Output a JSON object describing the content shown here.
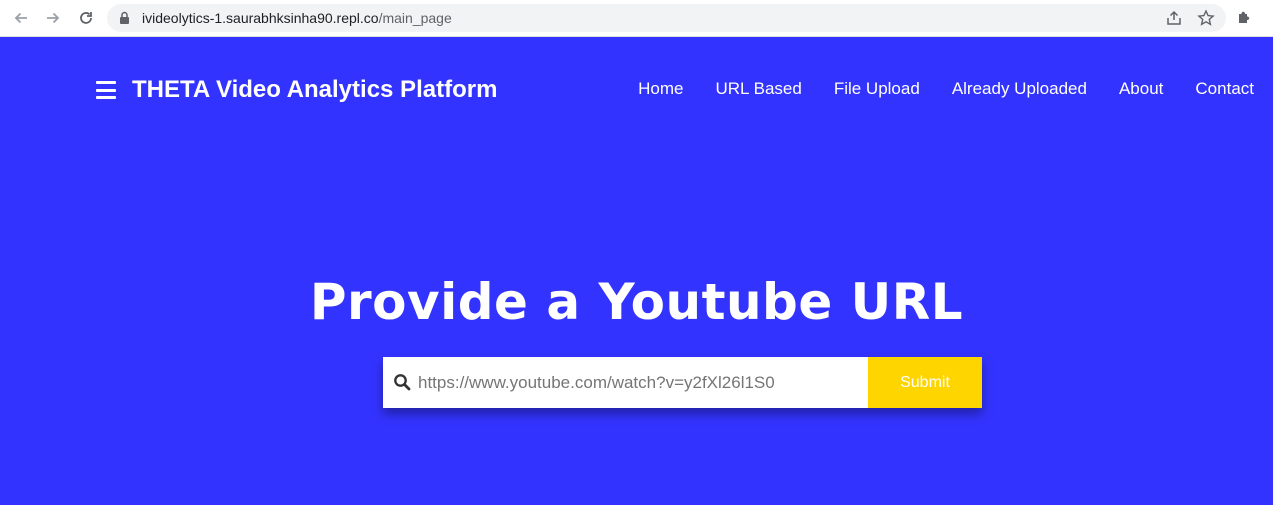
{
  "browser": {
    "url_host": "ivideolytics-1.saurabhksinha90.repl.co",
    "url_path": "/main_page",
    "icons": [
      "back-arrow-icon",
      "forward-arrow-icon",
      "reload-icon",
      "lock-icon",
      "share-icon",
      "star-icon",
      "extensions-icon"
    ]
  },
  "header": {
    "brand": "THETA Video Analytics Platform",
    "nav": [
      "Home",
      "URL Based",
      "File Upload",
      "Already Uploaded",
      "About",
      "Contact"
    ]
  },
  "hero": {
    "title": "Provide a Youtube URL",
    "input_placeholder": "https://www.youtube.com/watch?v=y2fXl26l1S0",
    "submit_label": "Submit"
  },
  "colors": {
    "page_background": "#3333ff",
    "submit_background": "#ffd500",
    "text": "#ffffff"
  }
}
